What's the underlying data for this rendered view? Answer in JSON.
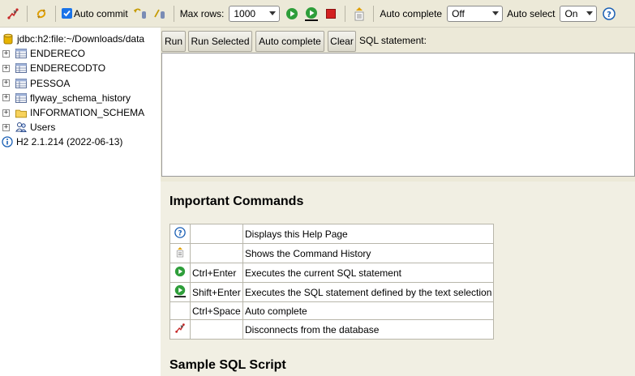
{
  "toolbar": {
    "auto_commit_label": "Auto commit",
    "max_rows_label": "Max rows:",
    "max_rows_value": "1000",
    "auto_complete_label": "Auto complete",
    "auto_complete_value": "Off",
    "auto_select_label": "Auto select",
    "auto_select_value": "On"
  },
  "tree": {
    "connection": "jdbc:h2:file:~/Downloads/data",
    "tables": [
      "ENDERECO",
      "ENDERECODTO",
      "PESSOA",
      "flyway_schema_history"
    ],
    "schema": "INFORMATION_SCHEMA",
    "users": "Users",
    "version": "H2 2.1.214 (2022-06-13)"
  },
  "query": {
    "run": "Run",
    "run_selected": "Run Selected",
    "auto_complete": "Auto complete",
    "clear": "Clear",
    "label": "SQL statement:"
  },
  "help": {
    "title": "Important Commands",
    "rows": [
      {
        "icon": "help-icon",
        "key": "",
        "desc": "Displays this Help Page"
      },
      {
        "icon": "history-icon",
        "key": "",
        "desc": "Shows the Command History"
      },
      {
        "icon": "run-icon",
        "key": "Ctrl+Enter",
        "desc": "Executes the current SQL statement"
      },
      {
        "icon": "run-selected-icon",
        "key": "Shift+Enter",
        "desc": "Executes the SQL statement defined by the text selection"
      },
      {
        "icon": "",
        "key": "Ctrl+Space",
        "desc": "Auto complete"
      },
      {
        "icon": "disconnect-icon",
        "key": "",
        "desc": "Disconnects from the database"
      }
    ],
    "sample_title": "Sample SQL Script"
  },
  "colors": {
    "toolbar_bg": "#ece9d8",
    "help_bg": "#f1efe3",
    "run_green": "#2e9e3a",
    "stop_red": "#d32020",
    "info_blue": "#1a5fb4"
  }
}
